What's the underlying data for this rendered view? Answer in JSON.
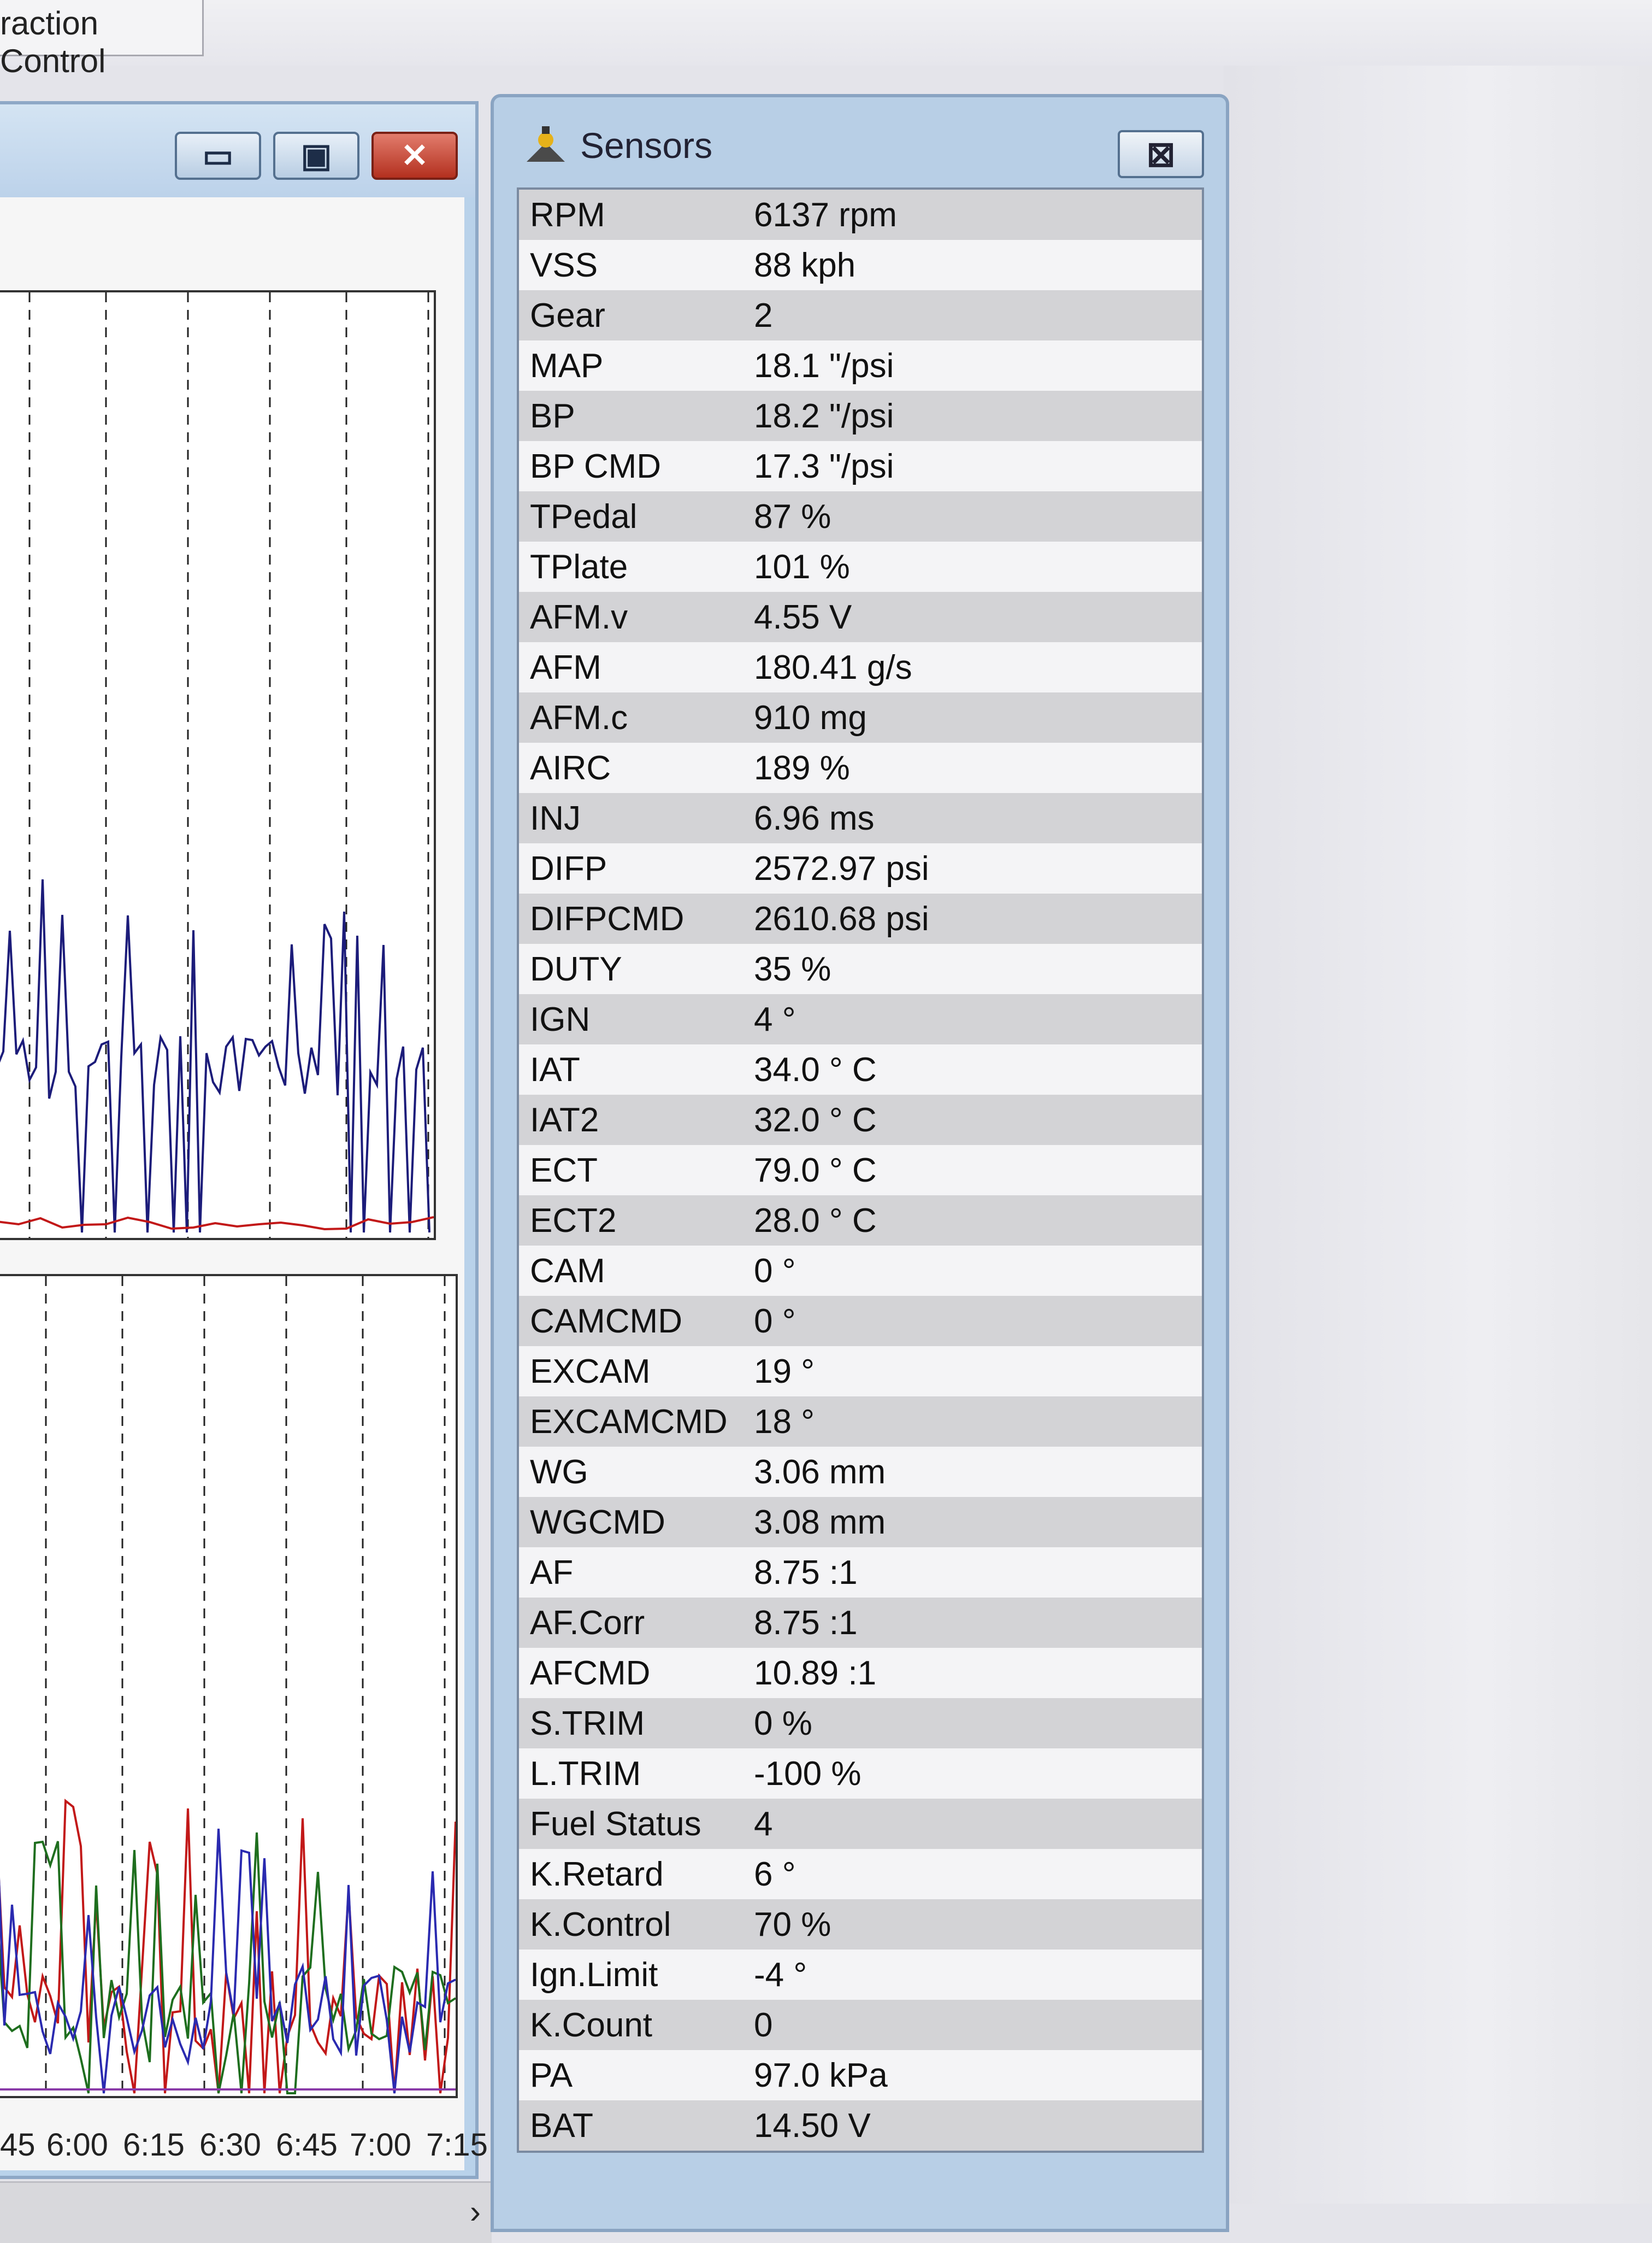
{
  "tab": {
    "label": "raction Control"
  },
  "graph_window": {
    "minimize_glyph": "▭",
    "restore_glyph": "▣",
    "close_glyph": "✕",
    "x_ticks": [
      "45",
      "6:00",
      "6:15",
      "6:30",
      "6:45",
      "7:00",
      "7:15"
    ],
    "scroll_arrow": "›",
    "colors": {
      "top_trace": "#1c1c7a",
      "baseline": "#c21818",
      "red": "#c21818",
      "green": "#1e6e1e",
      "blue": "#2a2ab0",
      "purple": "#8a3aa8"
    }
  },
  "sensors": {
    "title": "Sensors",
    "close_glyph": "⊠",
    "rows": [
      {
        "name": "RPM",
        "value": "6137 rpm"
      },
      {
        "name": "VSS",
        "value": "88 kph"
      },
      {
        "name": "Gear",
        "value": "2"
      },
      {
        "name": "MAP",
        "value": "18.1 \"/psi"
      },
      {
        "name": "BP",
        "value": "18.2 \"/psi"
      },
      {
        "name": "BP CMD",
        "value": "17.3 \"/psi"
      },
      {
        "name": "TPedal",
        "value": "87 %"
      },
      {
        "name": "TPlate",
        "value": "101 %"
      },
      {
        "name": "AFM.v",
        "value": "4.55 V"
      },
      {
        "name": "AFM",
        "value": "180.41 g/s"
      },
      {
        "name": "AFM.c",
        "value": "910 mg"
      },
      {
        "name": "AIRC",
        "value": "189 %"
      },
      {
        "name": "INJ",
        "value": "6.96 ms"
      },
      {
        "name": "DIFP",
        "value": "2572.97 psi"
      },
      {
        "name": "DIFPCMD",
        "value": "2610.68 psi"
      },
      {
        "name": "DUTY",
        "value": "35 %"
      },
      {
        "name": "IGN",
        "value": "4 °"
      },
      {
        "name": "IAT",
        "value": "34.0 ° C"
      },
      {
        "name": "IAT2",
        "value": "32.0 ° C"
      },
      {
        "name": "ECT",
        "value": "79.0 ° C"
      },
      {
        "name": "ECT2",
        "value": "28.0 ° C"
      },
      {
        "name": "CAM",
        "value": "0 °"
      },
      {
        "name": "CAMCMD",
        "value": "0 °"
      },
      {
        "name": "EXCAM",
        "value": "19 °"
      },
      {
        "name": "EXCAMCMD",
        "value": "18 °"
      },
      {
        "name": "WG",
        "value": "3.06 mm"
      },
      {
        "name": "WGCMD",
        "value": "3.08 mm"
      },
      {
        "name": "AF",
        "value": "8.75 :1"
      },
      {
        "name": "AF.Corr",
        "value": "8.75 :1"
      },
      {
        "name": "AFCMD",
        "value": "10.89 :1"
      },
      {
        "name": "S.TRIM",
        "value": "0 %"
      },
      {
        "name": "L.TRIM",
        "value": "-100 %"
      },
      {
        "name": "Fuel Status",
        "value": "4"
      },
      {
        "name": "K.Retard",
        "value": "6 °"
      },
      {
        "name": "K.Control",
        "value": "70 %"
      },
      {
        "name": "Ign.Limit",
        "value": "-4 °"
      },
      {
        "name": "K.Count",
        "value": "0"
      },
      {
        "name": "PA",
        "value": "97.0 kPa"
      },
      {
        "name": "BAT",
        "value": "14.50 V"
      }
    ]
  }
}
